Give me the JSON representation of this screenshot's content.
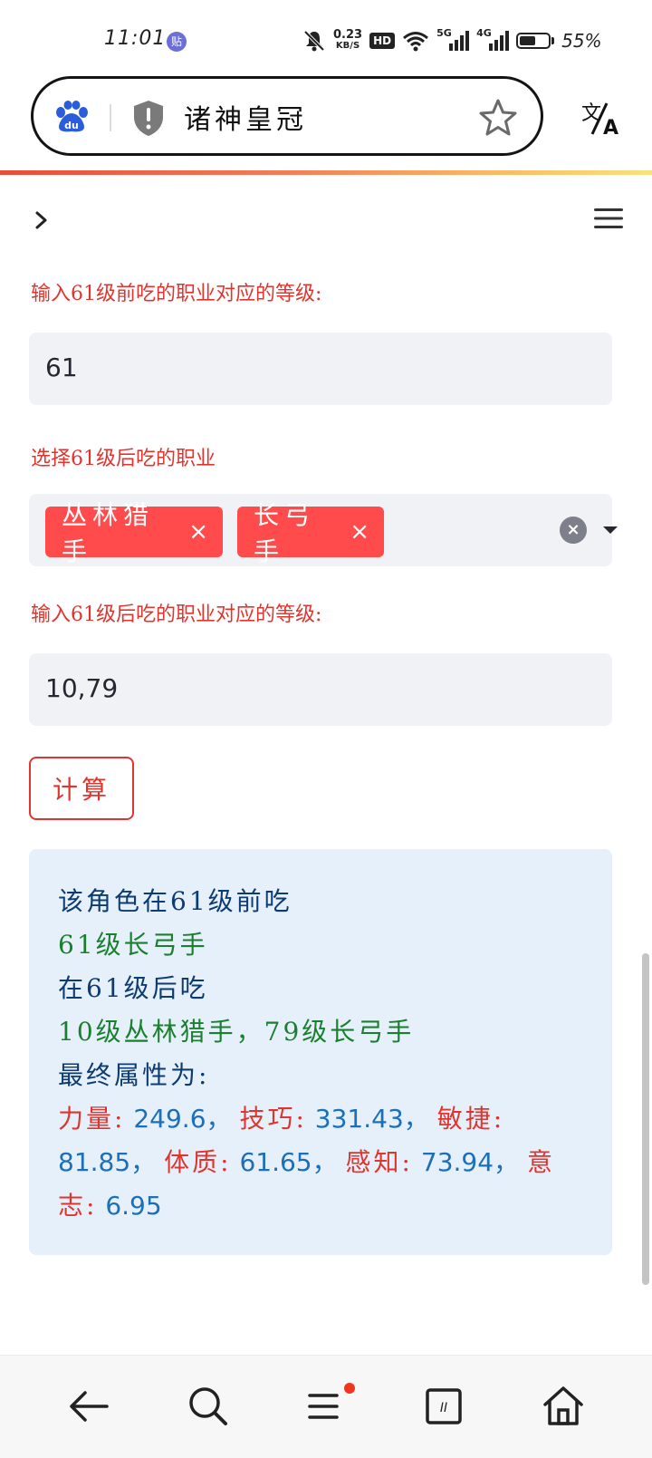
{
  "status_bar": {
    "time": "11:01",
    "app_badge": "贴",
    "net_speed_value": "0.23",
    "net_speed_unit": "KB/S",
    "hd_label": "HD",
    "signal1_gen": "5G",
    "signal2_gen": "4G",
    "battery_level": 0.55,
    "battery_text": "55%"
  },
  "browser": {
    "address_text": "诸神皇冠",
    "search_engine": "baidu-logo",
    "accent_gradient": [
      "#e84b3a",
      "#f9e27a"
    ]
  },
  "form": {
    "label_before_level": "输入61级前吃的职业对应的等级:",
    "before_level_value": "61",
    "label_after_class": "选择61级后吃的职业",
    "selected_classes": [
      {
        "label": "丛林猎手",
        "remove": "×"
      },
      {
        "label": "长弓手",
        "remove": "×"
      }
    ],
    "clear_all": "×",
    "label_after_level": "输入61级后吃的职业对应的等级:",
    "after_level_value": "10,79",
    "calculate_button": "计算"
  },
  "result": {
    "line1": "该角色在61级前吃",
    "line2": "61级长弓手",
    "line3": "在61级后吃",
    "line4": "10级丛林猎手，79级长弓手",
    "line5": "最终属性为:",
    "stats": [
      {
        "name": "力量:",
        "value": "249.6",
        "sep": "，"
      },
      {
        "name": "技巧:",
        "value": "331.43",
        "sep": "，"
      },
      {
        "name": "敏捷:",
        "value": "81.85",
        "sep": "，"
      },
      {
        "name": "体质:",
        "value": "61.65",
        "sep": "，"
      },
      {
        "name": "感知:",
        "value": "73.94",
        "sep": "，"
      },
      {
        "name_part1": "意",
        "name_part2": "志:",
        "value": "6.95"
      }
    ]
  },
  "colors": {
    "accent_red": "#ff4b4b",
    "label_red": "#e0352f",
    "result_bg": "#e6f0fb",
    "field_bg": "#f0f2f6"
  },
  "bottom_nav": {
    "items": [
      "back-arrow-icon",
      "search-icon",
      "menu-icon",
      "tabs-icon",
      "home-icon"
    ],
    "tab_count": "II"
  }
}
